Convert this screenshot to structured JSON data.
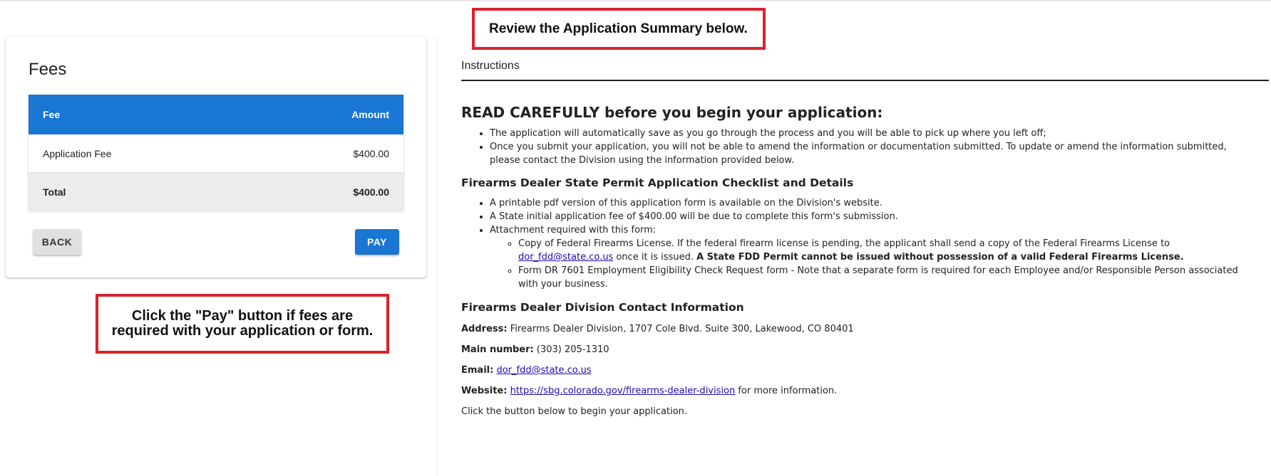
{
  "callouts": {
    "review": "Review the Application Summary below.",
    "pay_line1": "Click the \"Pay\" button if fees are",
    "pay_line2": "required with your application or form."
  },
  "fees": {
    "title": "Fees",
    "columns": [
      "Fee",
      "Amount"
    ],
    "rows": [
      {
        "fee": "Application Fee",
        "amount": "$400.00"
      }
    ],
    "total": {
      "label": "Total",
      "amount": "$400.00"
    },
    "back_label": "BACK",
    "pay_label": "PAY"
  },
  "instructions": {
    "tab_label": "Instructions",
    "heading": "READ CAREFULLY before you begin your application:",
    "intro_bullets": [
      "The application will automatically save as you go through the process and you will be able to pick up where you left off;",
      "Once you submit your application, you will not be able to amend the information or documentation submitted. To update or amend the information submitted, please contact the Division using the information provided below."
    ],
    "checklist_heading": "Firearms Dealer State Permit Application Checklist and Details",
    "checklist_bullets": [
      "A printable pdf version of this application form is available on the Division's website.",
      "A State initial application fee of $400.00 will be due to complete this form's submission.",
      "Attachment required with this form:"
    ],
    "attachment_1_pre": "Copy of Federal Firearms License. If the federal firearm license is pending, the applicant shall send a copy of the Federal Firearms License to ",
    "attachment_1_link": "dor_fdd@state.co.us",
    "attachment_1_post": " once it is issued. ",
    "attachment_1_bold": "A State FDD Permit cannot be issued without possession of a valid Federal Firearms License.",
    "attachment_2": "Form DR 7601 Employment Eligibility Check Request form - Note that a separate form is required for each Employee and/or Responsible Person associated with your business.",
    "contact_heading": "Firearms Dealer Division Contact Information",
    "address_label": "Address:",
    "address_value": " Firearms Dealer Division, 1707 Cole Blvd. Suite 300, Lakewood, CO 80401",
    "main_label": "Main number:",
    "main_value": " (303) 205-1310",
    "email_label": "Email:",
    "email_value": "dor_fdd@state.co.us",
    "website_label": "Website:",
    "website_value": "https://sbg.colorado.gov/firearms-dealer-division",
    "website_post": " for more information.",
    "closing": "Click the button below to begin your application."
  },
  "colors": {
    "primary": "#1976d2",
    "callout_border": "#d9232d",
    "link": "#1a0dab"
  }
}
